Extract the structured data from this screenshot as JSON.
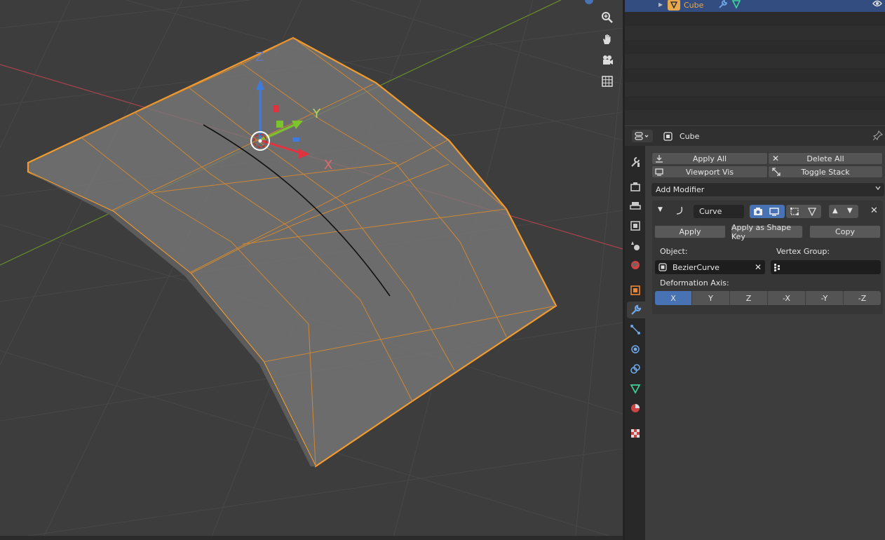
{
  "outliner": {
    "object_name": "Cube"
  },
  "properties": {
    "header_object": "Cube",
    "toolbar": {
      "apply_all": "Apply All",
      "delete_all": "Delete All",
      "viewport_vis": "Viewport Vis",
      "toggle_stack": "Toggle Stack"
    },
    "add_modifier": "Add Modifier",
    "modifier": {
      "name": "Curve",
      "apply": "Apply",
      "apply_shape_key": "Apply as Shape Key",
      "copy": "Copy",
      "object_label": "Object:",
      "object_value": "BezierCurve",
      "vertex_group_label": "Vertex Group:",
      "vertex_group_value": "",
      "axis_label": "Deformation Axis:",
      "axes": [
        "X",
        "Y",
        "Z",
        "-X",
        "-Y",
        "-Z"
      ],
      "active_axis": "X"
    }
  },
  "viewport": {
    "axis_labels": {
      "x": "X",
      "y": "Y",
      "z": "Z"
    },
    "selection_color": "#f29b2e",
    "nav_icons": [
      "zoom-icon",
      "hand-pan-icon",
      "camera-icon",
      "grid-icon"
    ]
  }
}
